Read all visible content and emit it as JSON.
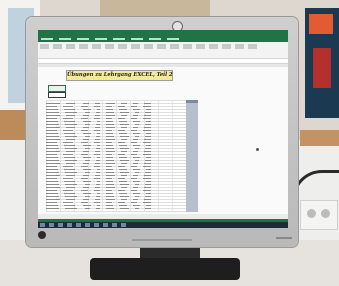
{
  "spreadsheet": {
    "heading": "Übungen zu Lehrgang EXCEL, Teil 2"
  },
  "colors": {
    "excel_green": "#217346",
    "heading_fill": "#f3ea96",
    "highlight_column": "#b7bfcc"
  },
  "icons": [
    "hp-logo-icon",
    "power-button-icon"
  ]
}
